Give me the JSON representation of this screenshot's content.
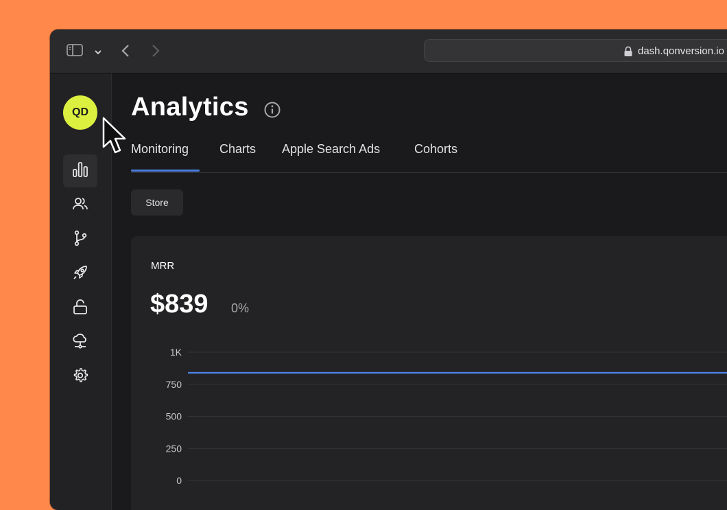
{
  "browser": {
    "url": "dash.qonversion.io"
  },
  "sidebar": {
    "avatar_initials": "QD",
    "items": [
      {
        "icon": "analytics-icon",
        "active": true
      },
      {
        "icon": "users-icon",
        "active": false
      },
      {
        "icon": "branch-icon",
        "active": false
      },
      {
        "icon": "rocket-icon",
        "active": false
      },
      {
        "icon": "unlock-icon",
        "active": false
      },
      {
        "icon": "cloud-icon",
        "active": false
      },
      {
        "icon": "gear-icon",
        "active": false
      }
    ]
  },
  "page": {
    "title": "Analytics",
    "tabs": [
      {
        "label": "Monitoring",
        "active": true
      },
      {
        "label": "Charts",
        "active": false
      },
      {
        "label": "Apple Search Ads",
        "active": false
      },
      {
        "label": "Cohorts",
        "active": false
      }
    ],
    "filter_chip": "Store"
  },
  "metric_card": {
    "label": "MRR",
    "value": "$839",
    "delta": "0%"
  },
  "colors": {
    "background": "#ff884a",
    "accent": "#4a7fe0",
    "avatar": "#dcf13f",
    "line": "#4a7fe0"
  },
  "chart_data": {
    "type": "line",
    "title": "",
    "xlabel": "",
    "ylabel": "",
    "ylim": [
      0,
      1000
    ],
    "yticks": [
      {
        "value": 1000,
        "label": "1K"
      },
      {
        "value": 750,
        "label": "750"
      },
      {
        "value": 500,
        "label": "500"
      },
      {
        "value": 250,
        "label": "250"
      },
      {
        "value": 0,
        "label": "0"
      }
    ],
    "series": [
      {
        "values": [
          839,
          839
        ]
      }
    ],
    "grid": true
  }
}
